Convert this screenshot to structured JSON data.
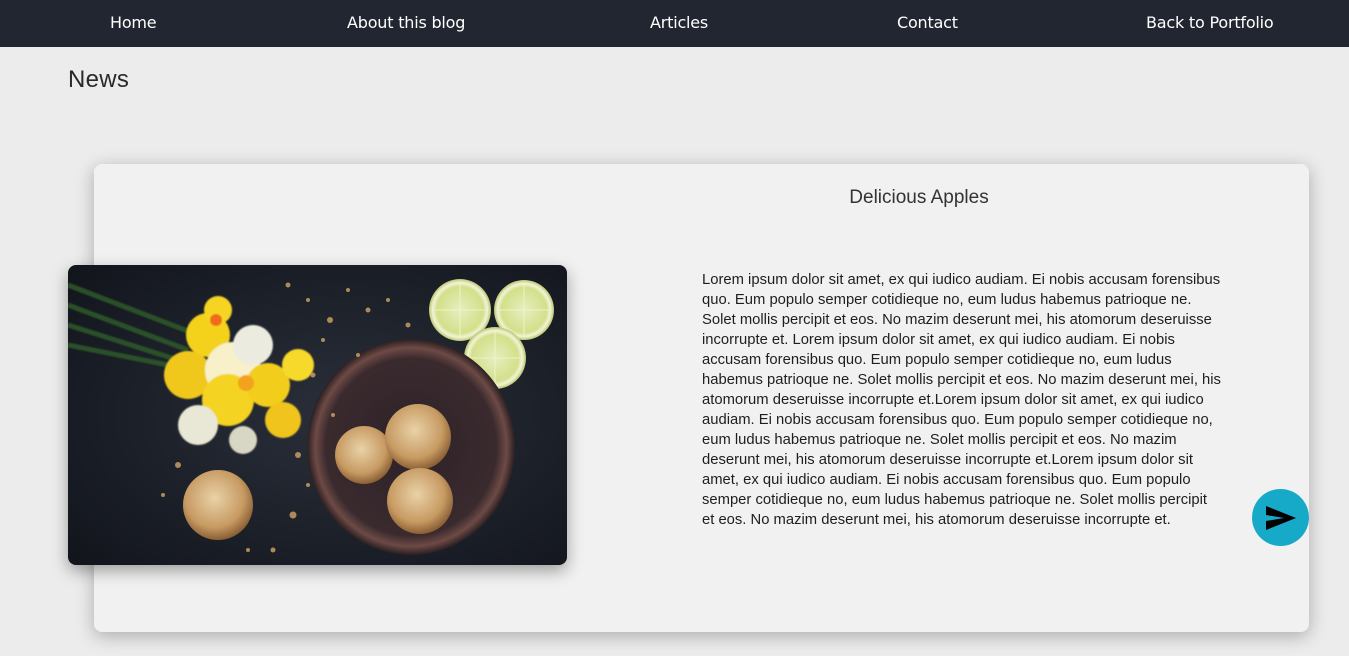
{
  "nav": {
    "items": [
      {
        "label": "Home"
      },
      {
        "label": "About this blog"
      },
      {
        "label": "Articles"
      },
      {
        "label": "Contact"
      },
      {
        "label": "Back to Portfolio"
      }
    ]
  },
  "page": {
    "title": "News"
  },
  "article": {
    "title": "Delicious Apples",
    "body": "Lorem ipsum dolor sit amet, ex qui iudico audiam. Ei nobis accusam forensibus quo. Eum populo semper cotidieque no, eum ludus habemus patrioque ne. Solet mollis percipit et eos. No mazim deserunt mei, his atomorum deseruisse incorrupte et. Lorem ipsum dolor sit amet, ex qui iudico audiam. Ei nobis accusam forensibus quo. Eum populo semper cotidieque no, eum ludus habemus patrioque ne. Solet mollis percipit et eos. No mazim deserunt mei, his atomorum deseruisse incorrupte et.Lorem ipsum dolor sit amet, ex qui iudico audiam. Ei nobis accusam forensibus quo. Eum populo semper cotidieque no, eum ludus habemus patrioque ne. Solet mollis percipit et eos. No mazim deserunt mei, his atomorum deseruisse incorrupte et.Lorem ipsum dolor sit amet, ex qui iudico audiam. Ei nobis accusam forensibus quo. Eum populo semper cotidieque no, eum ludus habemus patrioque ne. Solet mollis percipit et eos. No mazim deserunt mei, his atomorum deseruisse incorrupte et.",
    "image_icon": "food-photo-cookies-daffodils-lemons",
    "action_icon": "send-icon"
  },
  "colors": {
    "navbar": "#212630",
    "page_background": "#ececec",
    "card_background": "#f1f1f1",
    "accent": "#17a9c8"
  }
}
